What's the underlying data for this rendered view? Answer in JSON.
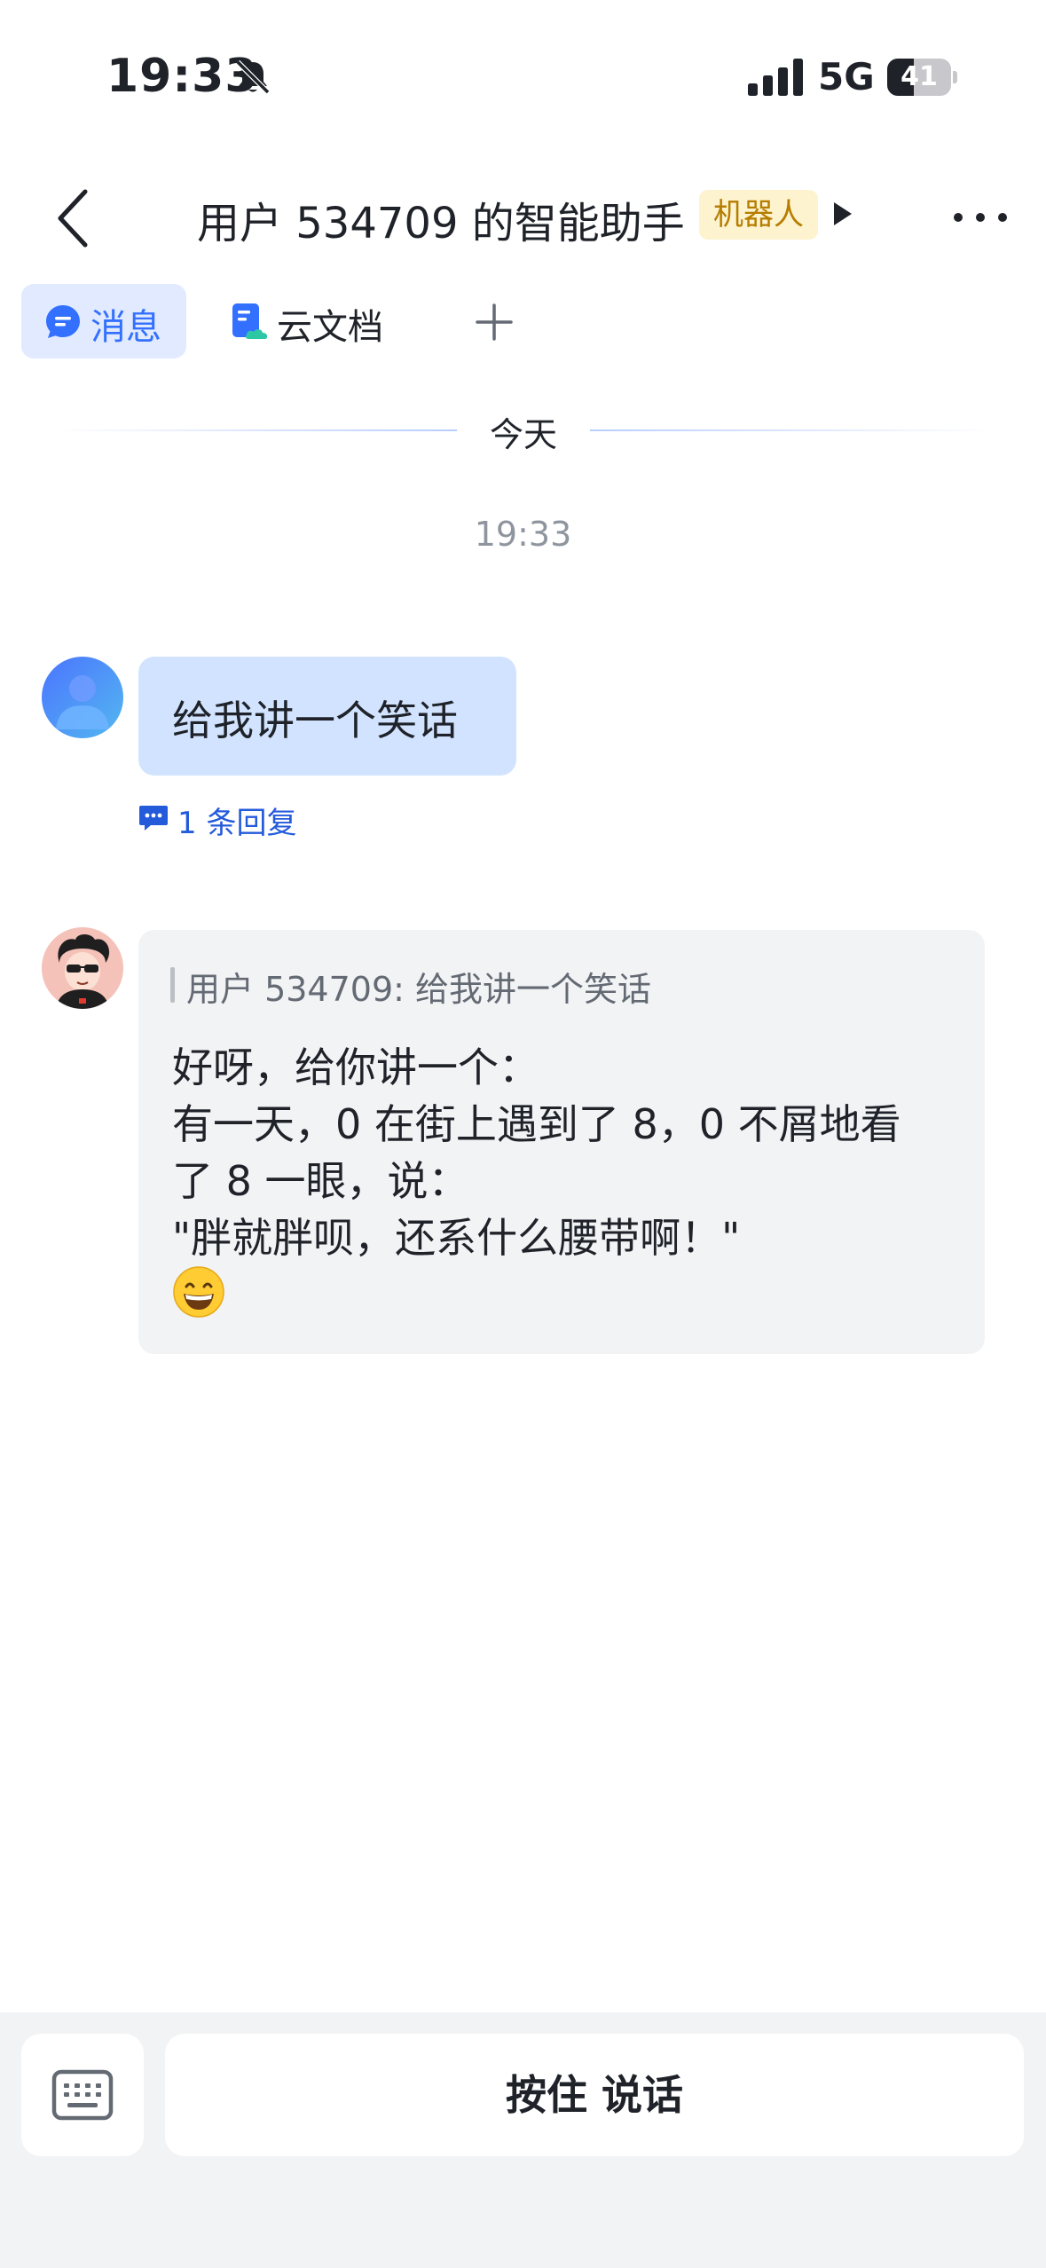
{
  "status_bar": {
    "time": "19:33",
    "network": "5G",
    "battery": "41",
    "battery_level": 0.41,
    "icons": [
      "bell-muted-icon",
      "signal-icon"
    ]
  },
  "header": {
    "title": "用户 534709 的智能助手",
    "tag": "机器人",
    "icons": [
      "back-icon",
      "play-icon",
      "more-icon"
    ]
  },
  "tabs": [
    {
      "label": "消息",
      "icon": "message-icon",
      "active": true
    },
    {
      "label": "云文档",
      "icon": "doc-icon",
      "active": false
    }
  ],
  "add_tab_icon": "plus-icon",
  "chat": {
    "date_divider": "今天",
    "timestamp": "19:33",
    "user_message": {
      "text": "给我讲一个笑话",
      "reply_count_text": "1 条回复",
      "reply_icon": "reply-icon"
    },
    "bot_message": {
      "quote": "用户 534709: 给我讲一个笑话",
      "lines": [
        "好呀，给你讲一个：",
        "有一天，0 在街上遇到了 8，0 不屑地看",
        "了 8 一眼，说：",
        "\"胖就胖呗，还系什么腰带啊！\""
      ],
      "emoji": "grinning-face-icon"
    }
  },
  "input_bar": {
    "keyboard_icon": "keyboard-icon",
    "hold_to_talk_label": "按住 说话"
  },
  "colors": {
    "accent": "#3370ff",
    "user_bubble": "#d1e3ff",
    "bot_bubble": "#f2f3f5",
    "tag_bg": "#fdf3cf",
    "tag_text": "#b67d00",
    "link": "#245bdb"
  }
}
